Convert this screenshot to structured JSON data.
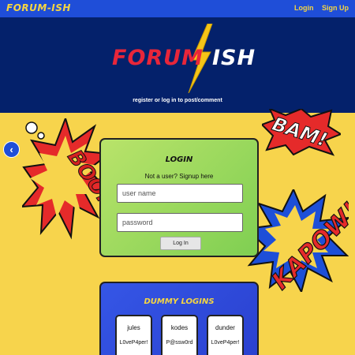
{
  "nav": {
    "brand": "FORUM-ISH",
    "login": "Login",
    "signup": "Sign Up"
  },
  "hero": {
    "logo_part1": "FORUM",
    "logo_part2": "ISH",
    "tagline": "register or log in to post/comment"
  },
  "decorations": {
    "boom": "BOOM!",
    "bam": "BAM!",
    "kapow": "KAPOW!"
  },
  "carousel": {
    "prev_icon": "‹"
  },
  "login": {
    "title": "LOGIN",
    "signup_hint": "Not a user? Signup here",
    "username_placeholder": "user name",
    "password_placeholder": "password",
    "button": "Log In"
  },
  "dummy": {
    "title": "DUMMY LOGINS",
    "accounts": [
      {
        "user": "jules",
        "pass": "L0veP4per!"
      },
      {
        "user": "kodes",
        "pass": "P@ssw0rd"
      },
      {
        "user": "dunder",
        "pass": "L0veP4per!"
      }
    ]
  },
  "colors": {
    "page_bg": "#f7d44c",
    "nav_bg": "#1f4ed8",
    "hero_bg": "#04216b",
    "accent_yellow": "#f5d542",
    "logo_red": "#e8263a",
    "login_green": "#8fd65a",
    "dummy_blue": "#2f4ddb"
  }
}
